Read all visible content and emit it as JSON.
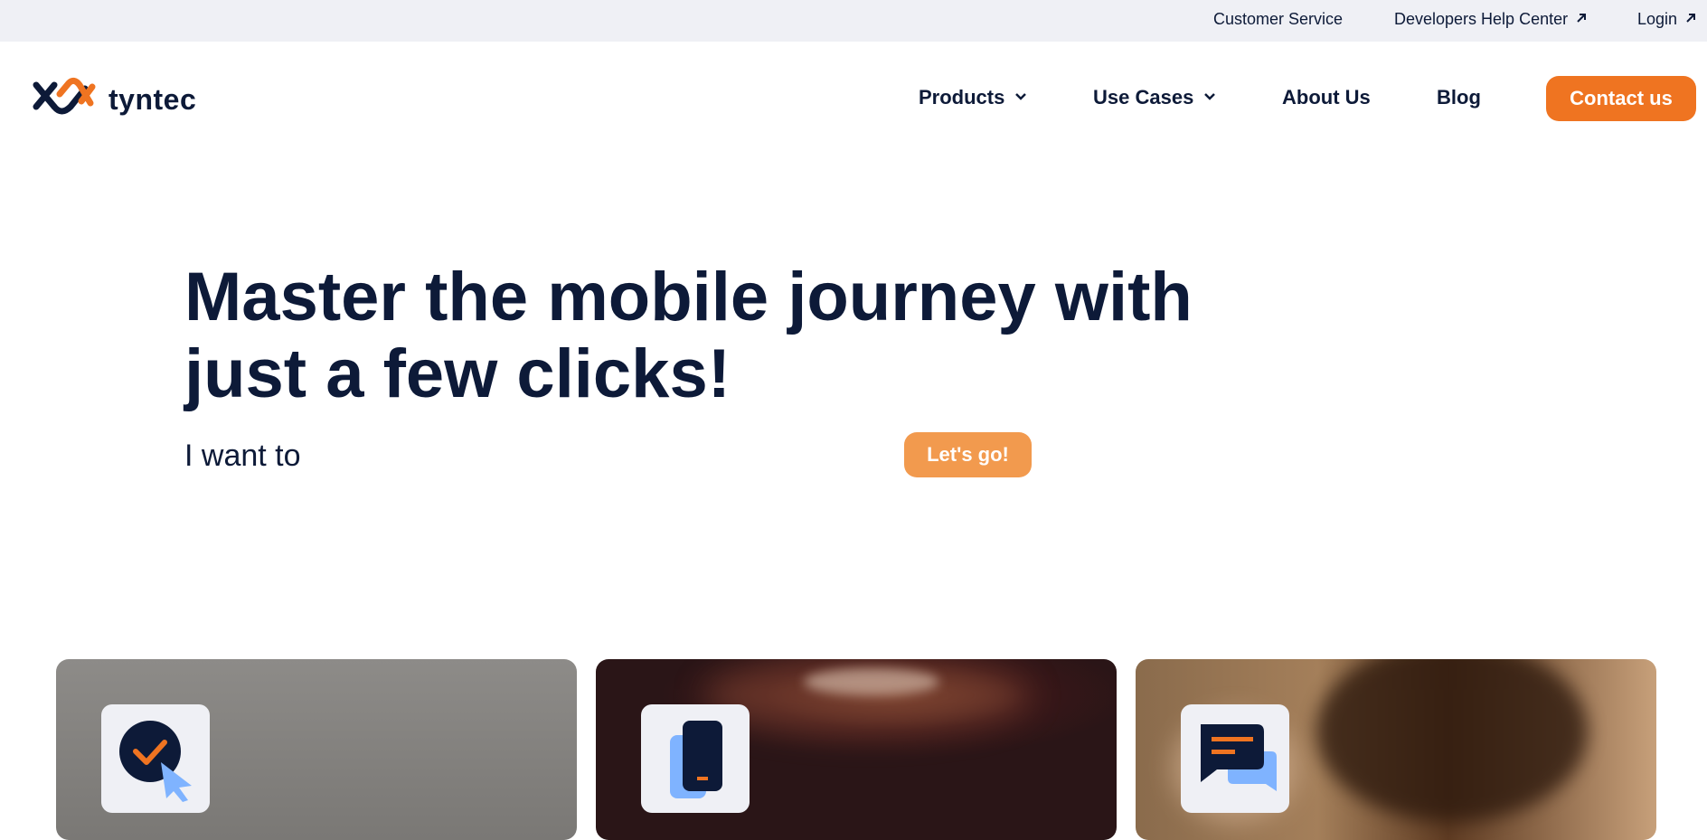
{
  "topbar": {
    "customer_service": "Customer Service",
    "developers_help_center": "Developers Help Center",
    "login": "Login"
  },
  "brand": {
    "name": "tyntec"
  },
  "nav": {
    "products": "Products",
    "use_cases": "Use Cases",
    "about_us": "About Us",
    "blog": "Blog",
    "contact_us": "Contact us"
  },
  "hero": {
    "title": "Master the mobile journey with just a few clicks!",
    "subtitle": "I want to",
    "cta": "Let's go!"
  },
  "cards": [
    {
      "icon": "checkmark-cursor-icon"
    },
    {
      "icon": "mobile-phone-icon"
    },
    {
      "icon": "chat-bubbles-icon"
    }
  ],
  "colors": {
    "accent": "#ef7421",
    "accent_light": "#f29a4e",
    "navy": "#0d1a38",
    "light_blue": "#7fb3ff",
    "topbar_bg": "#eff0f5"
  }
}
